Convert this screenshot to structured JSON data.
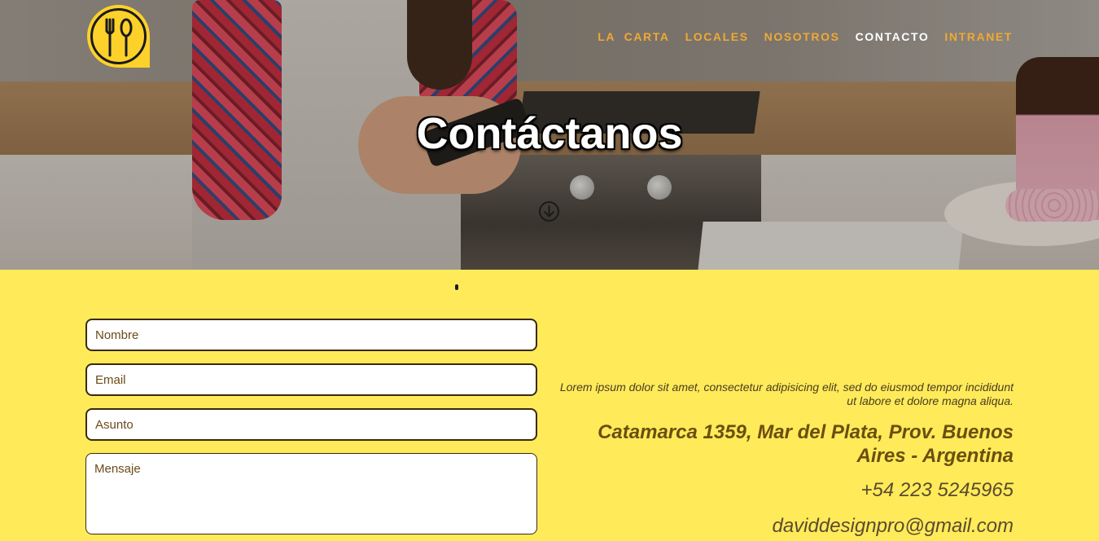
{
  "nav": {
    "items": [
      {
        "label": "LA  CARTA",
        "active": false
      },
      {
        "label": "LOCALES",
        "active": false
      },
      {
        "label": "NOSOTROS",
        "active": false
      },
      {
        "label": "CONTACTO",
        "active": true
      },
      {
        "label": "INTRANET",
        "active": false
      }
    ]
  },
  "logo": {
    "icon": "fork-spoon-icon",
    "color": "#fcd12a"
  },
  "hero": {
    "title": "Contáctanos",
    "scroll_icon": "arrow-down-circle-icon"
  },
  "form": {
    "name_placeholder": "Nombre",
    "email_placeholder": "Email",
    "subject_placeholder": "Asunto",
    "message_placeholder": "Mensaje"
  },
  "contact_info": {
    "description": "Lorem ipsum dolor sit amet, consectetur adipisicing elit, sed do eiusmod tempor incididunt ut labore et dolore magna aliqua.",
    "address": "Catamarca 1359, Mar del Plata, Prov. Buenos Aires - Argentina",
    "phone": "+54 223 5245965",
    "email": "daviddesignpro@gmail.com"
  },
  "colors": {
    "background": "#ffeb59",
    "nav_link": "#f0a935",
    "nav_active": "#ffffff",
    "address_text": "#6b4e0f"
  }
}
